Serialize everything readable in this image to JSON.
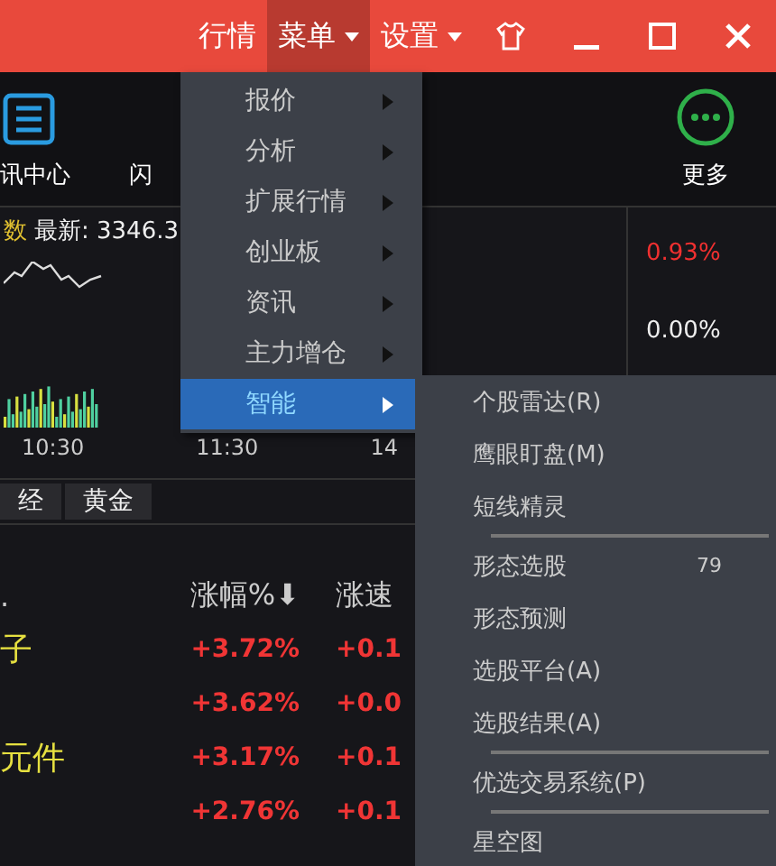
{
  "title_bar": {
    "items": [
      {
        "label": "行情",
        "dropdown": false,
        "selected": false
      },
      {
        "label": "菜单",
        "dropdown": true,
        "selected": true
      },
      {
        "label": "设置",
        "dropdown": true,
        "selected": false
      }
    ]
  },
  "toolbar": {
    "items": [
      {
        "label": "讯中心",
        "kind": "news"
      },
      {
        "label": "闪",
        "kind": "blank"
      },
      {
        "label": "更多",
        "kind": "more"
      }
    ]
  },
  "chart": {
    "index_name": "数",
    "latest": "最新: 3346.3",
    "right_values": [
      "0.93%",
      "0.00%"
    ],
    "times": [
      "10:30",
      "11:30",
      "14"
    ]
  },
  "tabs": [
    {
      "label": "经",
      "selected": false
    },
    {
      "label": "黄金",
      "selected": false
    }
  ],
  "table": {
    "columns": [
      ".",
      "涨幅%⬇",
      "涨速"
    ],
    "rows": [
      {
        "name": "子",
        "change": "+3.72%",
        "speed": "+0.1"
      },
      {
        "name": "",
        "change": "+3.62%",
        "speed": "+0.0"
      },
      {
        "name": "元件",
        "change": "+3.17%",
        "speed": "+0.1"
      },
      {
        "name": "",
        "change": "+2.76%",
        "speed": "+0.1"
      }
    ]
  },
  "menu": {
    "items": [
      {
        "label": "报价",
        "selected": false
      },
      {
        "label": "分析",
        "selected": false
      },
      {
        "label": "扩展行情",
        "selected": false
      },
      {
        "label": "创业板",
        "selected": false
      },
      {
        "label": "资讯",
        "selected": false
      },
      {
        "label": "主力增仓",
        "selected": false
      },
      {
        "label": "智能",
        "selected": true
      }
    ]
  },
  "submenu": {
    "groups": [
      [
        {
          "label": "个股雷达(R)"
        },
        {
          "label": "鹰眼盯盘(M)"
        },
        {
          "label": "短线精灵"
        }
      ],
      [
        {
          "label": "形态选股",
          "shortcut": "79"
        },
        {
          "label": "形态预测"
        },
        {
          "label": "选股平台(A)"
        },
        {
          "label": "选股结果(A)"
        }
      ],
      [
        {
          "label": "优选交易系统(P)"
        }
      ],
      [
        {
          "label": "星空图"
        }
      ]
    ]
  }
}
